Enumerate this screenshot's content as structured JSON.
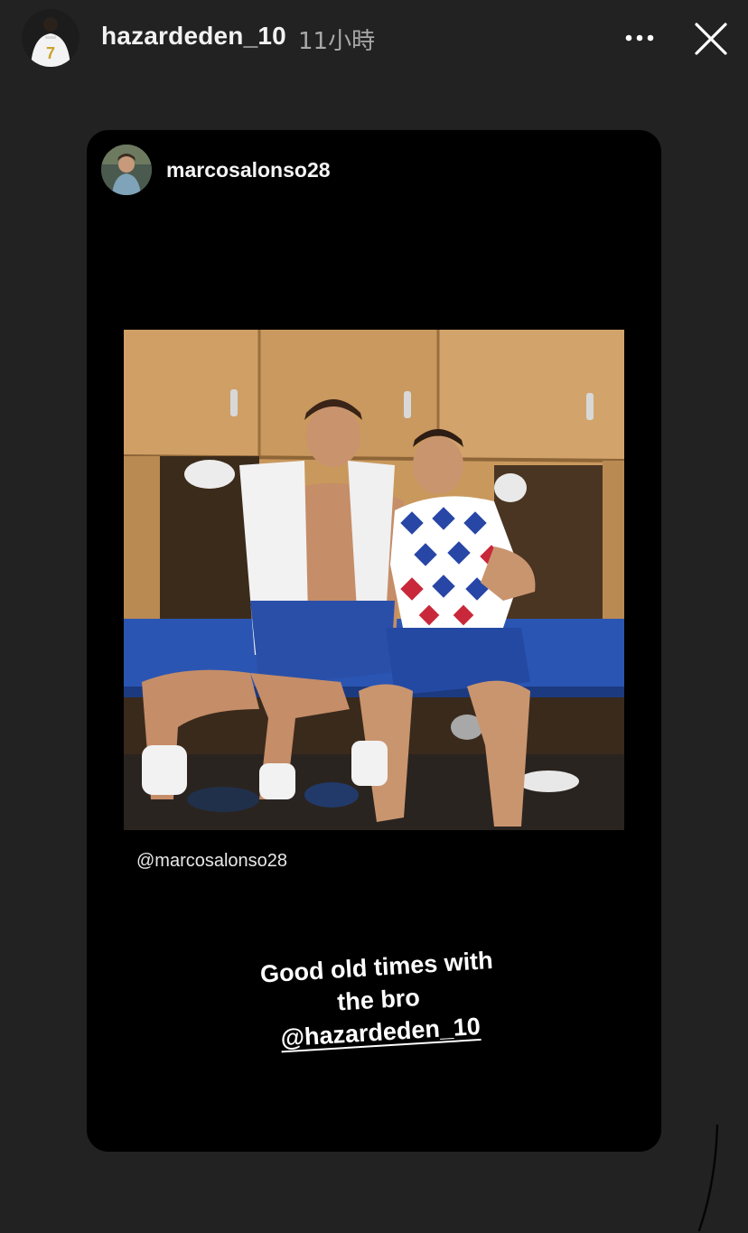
{
  "story": {
    "author": "hazardeden_10",
    "timestamp": "11小時",
    "more_icon": "more-horizontal-icon",
    "close_icon": "close-icon"
  },
  "shared_post": {
    "author": "marcosalonso28",
    "photo_credit": "@marcosalonso28",
    "caption_line1": "Good old times with",
    "caption_line2": "the bro",
    "caption_mention": "@hazardeden_10"
  },
  "colors": {
    "background": "#222222",
    "card": "#000000",
    "text_primary": "#ffffff",
    "text_secondary": "#a8a8a8"
  }
}
